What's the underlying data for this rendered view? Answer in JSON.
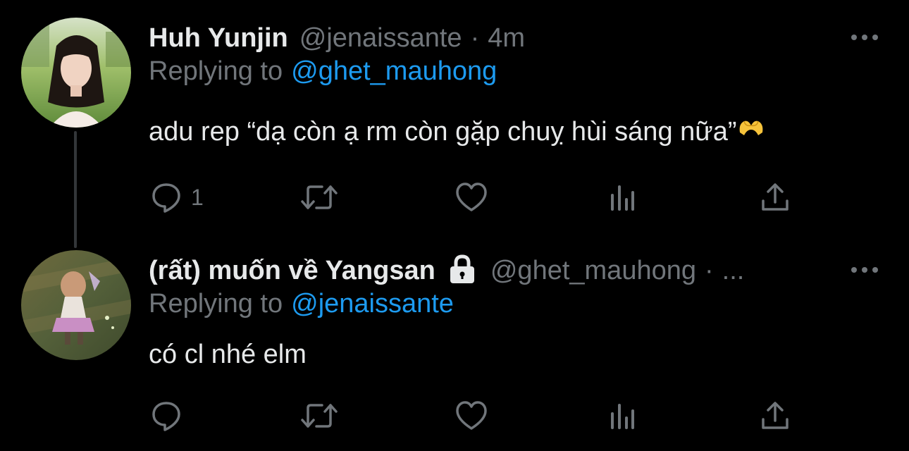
{
  "tweets": [
    {
      "display_name": "Huh Yunjin",
      "handle": "@jenaissante",
      "separator": "·",
      "time": "4m",
      "replying_to_label": "Replying to",
      "replying_to_handle": "@ghet_mauhong",
      "text": "adu rep “dạ còn ạ rm còn gặp chuỵ hùi sáng nữa”",
      "reply_count": "1",
      "protected": false
    },
    {
      "display_name": "(rất) muốn về Yangsan",
      "handle": "@ghet_mauhong",
      "separator": "·",
      "time": "...",
      "replying_to_label": "Replying to",
      "replying_to_handle": "@jenaissante",
      "text": "có cl nhé elm",
      "reply_count": "",
      "protected": true
    }
  ],
  "icons": {
    "reply": "reply-bubble-icon",
    "retweet": "retweet-icon",
    "like": "heart-icon",
    "views": "views-bar-icon",
    "share": "share-upload-icon",
    "more": "more-dots-icon",
    "lock": "lock-icon",
    "emoji": "heart-hands-emoji"
  },
  "colors": {
    "background": "#000000",
    "primary_text": "#e7e9ea",
    "secondary_text": "#71767b",
    "accent": "#1d9bf0",
    "thread_line": "#333639"
  }
}
